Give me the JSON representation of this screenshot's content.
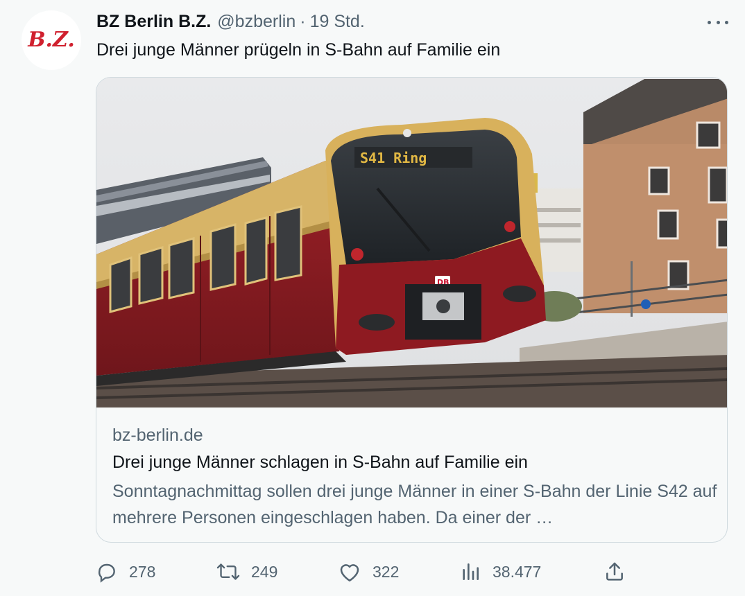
{
  "tweet": {
    "author_name": "BZ Berlin B.Z.",
    "handle": "@bzberlin",
    "separator": "·",
    "time": "19 Std.",
    "text": "Drei junge Männer prügeln in S-Bahn auf Familie ein",
    "avatar_logo_text": "B.Z."
  },
  "card": {
    "image_destination_sign": "S41 Ring",
    "image_db_logo": "DB",
    "domain": "bz-berlin.de",
    "title": "Drei junge Männer schlagen in S-Bahn auf Familie ein",
    "description": "Sonntagnachmittag sollen drei junge Männer in einer S-Bahn der Linie S42 auf mehrere Personen eingeschlagen haben. Da einer der …"
  },
  "actions": {
    "replies": "278",
    "retweets": "249",
    "likes": "322",
    "views": "38.477"
  },
  "icons": {
    "reply": "speech-bubble",
    "retweet": "repeat-arrows",
    "like": "heart",
    "views": "bar-chart",
    "share": "upload-arrow",
    "more": "three-dots"
  },
  "colors": {
    "secondary_text": "#536471",
    "brand_red": "#c8102e",
    "train_red": "#8e1b22",
    "train_yellow": "#d9b25c"
  }
}
